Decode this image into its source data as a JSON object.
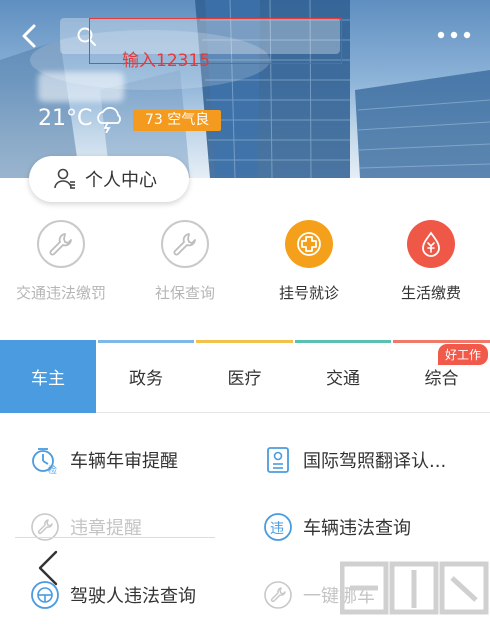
{
  "header": {
    "search_annotation": "输入12315",
    "temperature": "21°C",
    "aqi": "73 空气良",
    "user_center": "个人中心"
  },
  "quick_services": [
    {
      "label": "交通违法缴罚",
      "icon": "wrench-icon",
      "enabled": false
    },
    {
      "label": "社保查询",
      "icon": "wrench-icon",
      "enabled": false
    },
    {
      "label": "挂号就诊",
      "icon": "medical-cross-icon",
      "enabled": true,
      "color": "#f5a01a"
    },
    {
      "label": "生活缴费",
      "icon": "payment-drop-icon",
      "enabled": true,
      "color": "#ef5747"
    }
  ],
  "tabs": [
    {
      "label": "车主",
      "active": true,
      "color": "#4a9be0"
    },
    {
      "label": "政务",
      "active": false,
      "color": "#7fb8e8"
    },
    {
      "label": "医疗",
      "active": false,
      "color": "#f2c14e"
    },
    {
      "label": "交通",
      "active": false,
      "color": "#5ac1b0"
    },
    {
      "label": "综合",
      "active": false,
      "color": "#f07a6a"
    }
  ],
  "hot_badge": "好工作",
  "services": [
    {
      "label": "车辆年审提醒",
      "icon": "inspection-icon",
      "enabled": true
    },
    {
      "label": "国际驾照翻译认...",
      "icon": "license-doc-icon",
      "enabled": true
    },
    {
      "label": "违章提醒",
      "icon": "wrench-icon",
      "enabled": false
    },
    {
      "label": "车辆违法查询",
      "icon": "violation-icon",
      "enabled": true
    },
    {
      "label": "驾驶人违法查询",
      "icon": "steering-wheel-icon",
      "enabled": true
    },
    {
      "label": "一键挪车",
      "icon": "wrench-icon",
      "enabled": false
    }
  ],
  "colors": {
    "accent": "#4a9be0",
    "aqi": "#f39a1f",
    "annotation": "#e23b3b"
  }
}
